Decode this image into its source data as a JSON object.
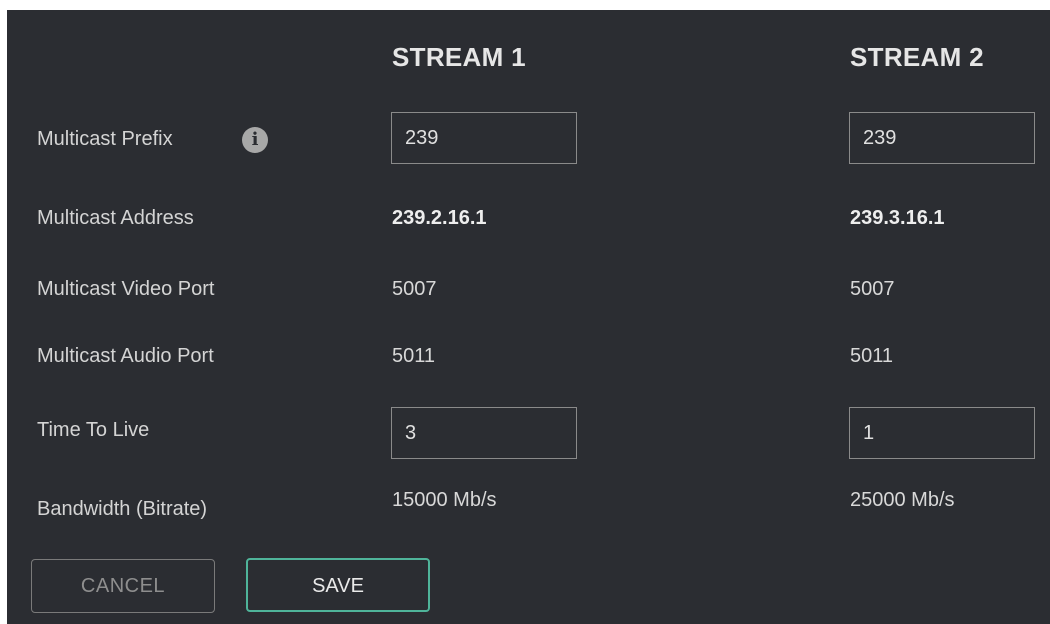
{
  "columns": {
    "stream1": "STREAM 1",
    "stream2": "STREAM 2"
  },
  "labels": {
    "multicast_prefix": "Multicast Prefix",
    "multicast_address": "Multicast Address",
    "multicast_video_port": "Multicast Video Port",
    "multicast_audio_port": "Multicast Audio Port",
    "time_to_live": "Time To Live",
    "bandwidth": "Bandwidth (Bitrate)"
  },
  "info_icon": "i",
  "stream1": {
    "multicast_prefix": "239",
    "multicast_address": "239.2.16.1",
    "multicast_video_port": "5007",
    "multicast_audio_port": "5011",
    "time_to_live": "3",
    "bandwidth": "15000  Mb/s"
  },
  "stream2": {
    "multicast_prefix": "239",
    "multicast_address": "239.3.16.1",
    "multicast_video_port": "5007",
    "multicast_audio_port": "5011",
    "time_to_live": "1",
    "bandwidth": "25000  Mb/s"
  },
  "buttons": {
    "cancel": "CANCEL",
    "save": "SAVE"
  },
  "colors": {
    "panel_bg": "#2b2d32",
    "save_accent": "#4fb49a"
  }
}
